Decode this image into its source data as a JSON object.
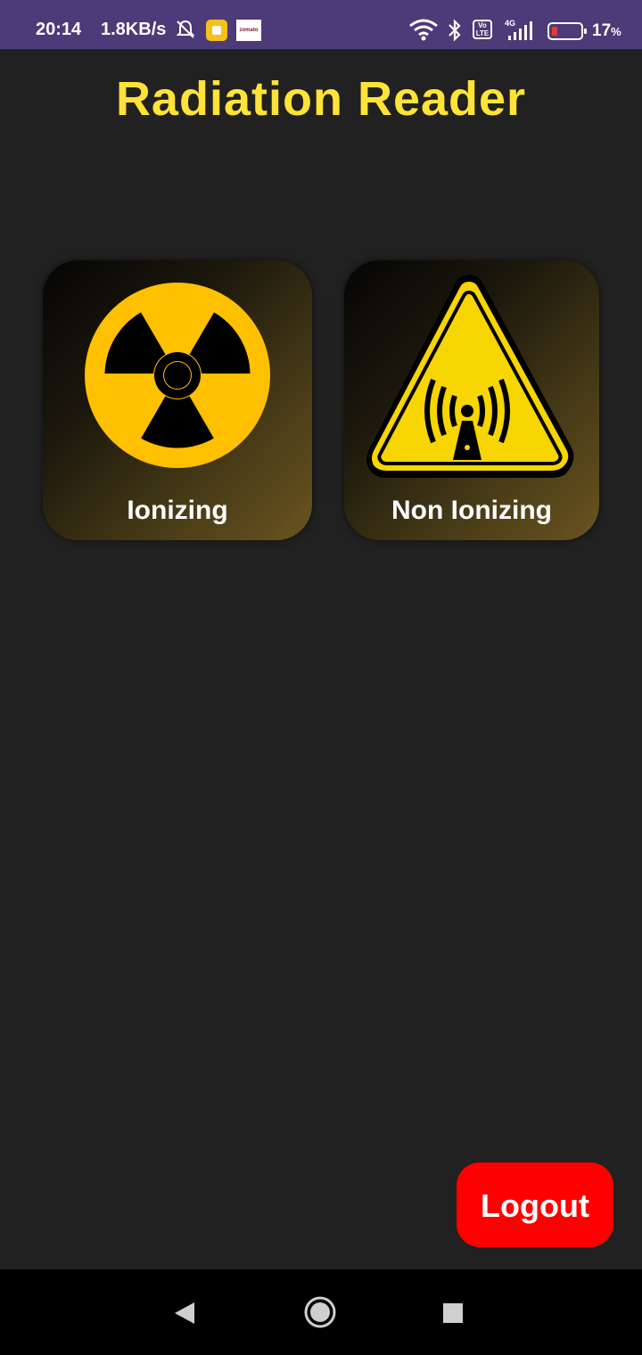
{
  "status_bar": {
    "time": "20:14",
    "net_speed": "1.8KB/s",
    "app2_label": "zomato",
    "volte_label": "Vo LTE",
    "network_label": "4G",
    "battery_percent": "17",
    "battery_unit": "%"
  },
  "title": "Radiation Reader",
  "cards": [
    {
      "label": "Ionizing",
      "icon": "radiation-trefoil-icon"
    },
    {
      "label": "Non Ionizing",
      "icon": "non-ionizing-warning-icon"
    }
  ],
  "logout_label": "Logout",
  "colors": {
    "status_bar": "#4d3a78",
    "background": "#212121",
    "title": "#ffe338",
    "icon_yellow": "#ffc000",
    "warning_yellow": "#f7d500",
    "logout": "#ff0000"
  },
  "nav": {
    "back_icon": "back-triangle-icon",
    "home_icon": "home-circle-icon",
    "recents_icon": "recents-square-icon"
  }
}
